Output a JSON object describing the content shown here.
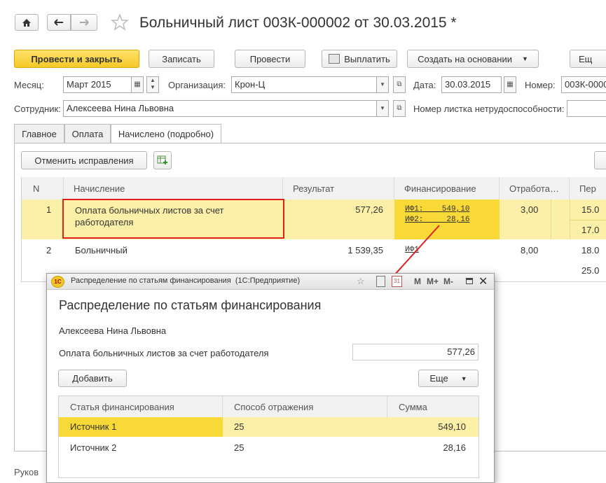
{
  "window": {
    "title": "Больничный лист 003К-000002 от 30.03.2015 *"
  },
  "toolbar": {
    "post_close": "Провести и закрыть",
    "save": "Записать",
    "post": "Провести",
    "pay": "Выплатить",
    "create_based": "Создать на основании",
    "more": "Ещ"
  },
  "form": {
    "month_label": "Месяц:",
    "month_value": "Март 2015",
    "org_label": "Организация:",
    "org_value": "Крон-Ц",
    "date_label": "Дата:",
    "date_value": "30.03.2015",
    "number_label": "Номер:",
    "number_value": "003К-0000",
    "employee_label": "Сотрудник:",
    "employee_value": "Алексеева Нина Львовна",
    "sheet_number_label": "Номер листка нетрудоспособности:"
  },
  "tabs": [
    "Главное",
    "Оплата",
    "Начислено (подробно)"
  ],
  "tab_toolbar": {
    "cancel_corrections": "Отменить исправления"
  },
  "table": {
    "columns": [
      "N",
      "Начисление",
      "Результат",
      "Финансирование",
      "Отработа…",
      "Пер"
    ],
    "rows": [
      {
        "n": "1",
        "accrual": "Оплата больничных листов за счет работодателя",
        "result": "577,26",
        "fin1": "ИФ1:    549,10",
        "fin2": "ИФ2:     28,16",
        "worked": "3,00",
        "period1": "15.0",
        "period2": "17.0"
      },
      {
        "n": "2",
        "accrual": "Больничный",
        "result": "1 539,35",
        "fin1": "ИФ1",
        "worked": "8,00",
        "period1": "18.0",
        "period2": "25.0"
      }
    ]
  },
  "footer_text": "Руков",
  "dialog": {
    "title": "Распределение по статьям финансирования  (1С:Предприятие)",
    "heading": "Распределение по статьям финансирования",
    "employee": "Алексеева Нина Львовна",
    "accrual_label": "Оплата больничных листов за счет работодателя",
    "accrual_value": "577,26",
    "add": "Добавить",
    "more": "Еще",
    "columns": [
      "Статья финансирования",
      "Способ отражения",
      "Сумма"
    ],
    "rows": [
      {
        "article": "Источник 1",
        "method": "25",
        "sum": "549,10"
      },
      {
        "article": "Источник 2",
        "method": "25",
        "sum": "28,16"
      }
    ],
    "icons": [
      "favorite-icon",
      "calculator-icon",
      "calendar-icon",
      "memory-m-icon",
      "memory-plus-icon",
      "memory-minus-icon",
      "maximize-icon",
      "close-icon"
    ],
    "memory_labels": [
      "M",
      "M+",
      "M-"
    ]
  },
  "colors": {
    "selected_row": "#fcf0a8",
    "selected_cell": "#f9d937",
    "highlight_border": "#e02020",
    "arrow": "#e02020",
    "primary_button": "#f5c827"
  }
}
